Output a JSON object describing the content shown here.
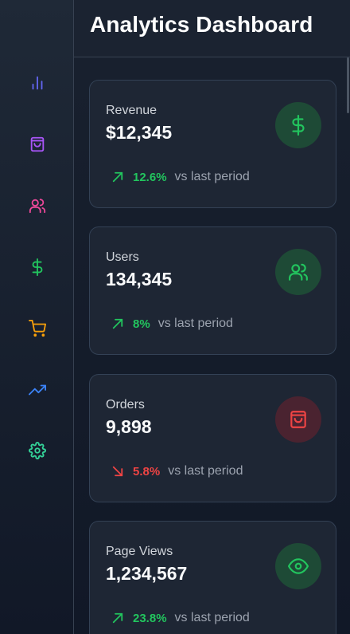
{
  "header": {
    "title": "Analytics Dashboard"
  },
  "sidebar": {
    "items": [
      {
        "icon": "bar-chart-icon",
        "color": "#6366f1"
      },
      {
        "icon": "shopping-bag-icon",
        "color": "#a855f7"
      },
      {
        "icon": "users-icon",
        "color": "#ec4899"
      },
      {
        "icon": "dollar-icon",
        "color": "#22c55e"
      },
      {
        "icon": "shopping-cart-icon",
        "color": "#f59e0b"
      },
      {
        "icon": "trending-up-icon",
        "color": "#3b82f6"
      },
      {
        "icon": "settings-icon",
        "color": "#34d399"
      }
    ]
  },
  "cards": [
    {
      "title": "Revenue",
      "value": "$12,345",
      "change": "12.6%",
      "trend": "up",
      "comparison": "vs last period",
      "icon": "dollar-icon"
    },
    {
      "title": "Users",
      "value": "134,345",
      "change": "8%",
      "trend": "up",
      "comparison": "vs last period",
      "icon": "users-icon"
    },
    {
      "title": "Orders",
      "value": "9,898",
      "change": "5.8%",
      "trend": "down",
      "comparison": "vs last period",
      "icon": "shopping-bag-icon"
    },
    {
      "title": "Page Views",
      "value": "1,234,567",
      "change": "23.8%",
      "trend": "up",
      "comparison": "vs last period",
      "icon": "eye-icon"
    }
  ],
  "colors": {
    "up": "#22c55e",
    "down": "#ef4444",
    "background": "#111827",
    "card": "#1e2634"
  }
}
